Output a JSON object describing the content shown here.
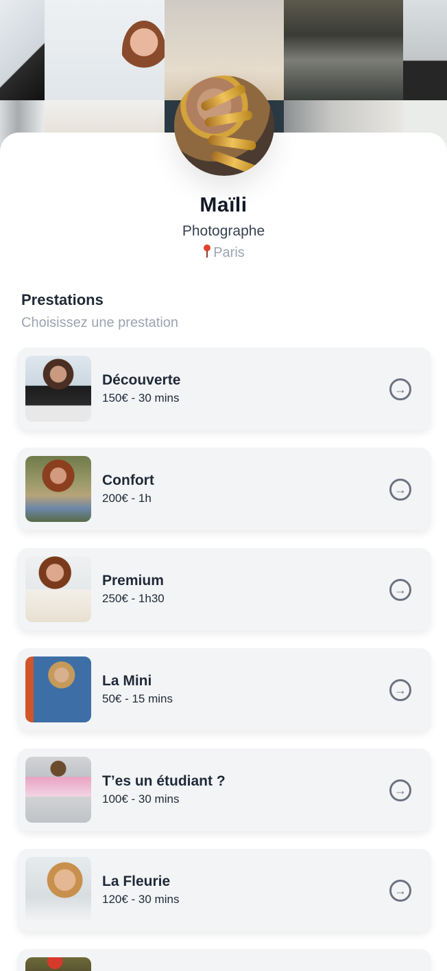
{
  "profile": {
    "name": "Maïli",
    "role": "Photographe",
    "location": "Paris"
  },
  "services_section": {
    "title": "Prestations",
    "subtitle": "Choisissez une prestation"
  },
  "services": [
    {
      "title": "Découverte",
      "meta": "150€ - 30 mins"
    },
    {
      "title": "Confort",
      "meta": "200€ - 1h"
    },
    {
      "title": "Premium",
      "meta": "250€ - 1h30"
    },
    {
      "title": "La Mini",
      "meta": "50€ - 15 mins"
    },
    {
      "title": "T’es un étudiant ?",
      "meta": "100€ - 30 mins"
    },
    {
      "title": "La Fleurie",
      "meta": "120€ - 30 mins"
    },
    {
      "title": "",
      "meta": ""
    }
  ],
  "icons": {
    "location": "map-pin-icon",
    "select_service": "arrow-right-circle-icon"
  }
}
